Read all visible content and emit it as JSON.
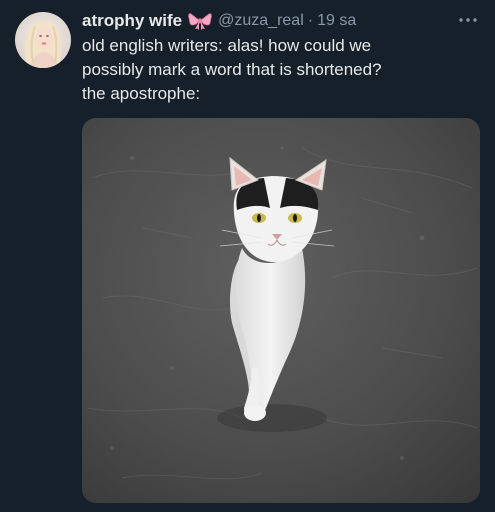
{
  "tweet": {
    "display_name": "atrophy wife",
    "handle": "@zuza_real",
    "separator": "·",
    "timestamp": "19 sa",
    "text_lines": [
      "old english writers: alas! how could we",
      "possibly mark a word that is shortened?",
      "the apostrophe:"
    ],
    "icons": {
      "name_badge": "pink-bow-emoji",
      "more": "more-options-icon"
    },
    "colors": {
      "background": "#15202b",
      "primary_text": "#e7e9ea",
      "secondary_text": "#8b98a5",
      "bow": "#f7a8c4"
    }
  }
}
